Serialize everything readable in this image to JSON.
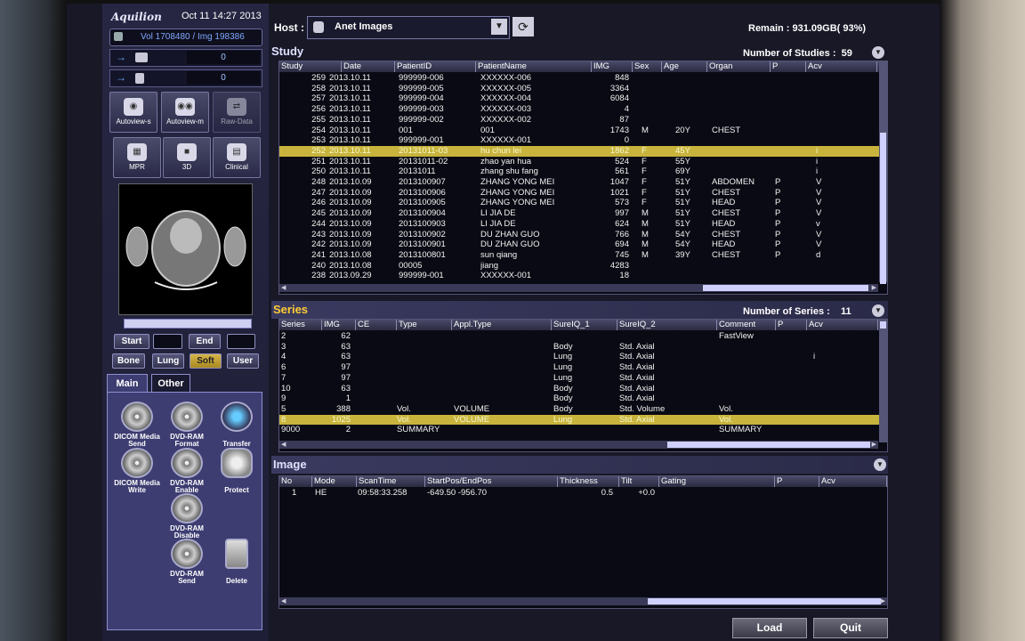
{
  "app": {
    "clock": "Oct 11 14:27 2013",
    "vol_info": "Vol 1708480 / Img 198386"
  },
  "queues": [
    {
      "value": "0"
    },
    {
      "value": "0"
    }
  ],
  "big_buttons": [
    {
      "label": "Autoview-s"
    },
    {
      "label": "Autoview-m"
    },
    {
      "label": "Raw-Data"
    },
    {
      "label": "MPR"
    },
    {
      "label": "3D"
    },
    {
      "label": "Clinical"
    }
  ],
  "range": {
    "start": "Start",
    "end": "End"
  },
  "windows": [
    "Bone",
    "Lung",
    "Soft",
    "User"
  ],
  "tabs": {
    "main": "Main",
    "other": "Other"
  },
  "actions": [
    {
      "label1": "DICOM Media",
      "label2": "Send"
    },
    {
      "label1": "DVD-RAM",
      "label2": "Format"
    },
    {
      "label1": "",
      "label2": "Transfer"
    },
    {
      "label1": "DICOM Media",
      "label2": "Write"
    },
    {
      "label1": "DVD-RAM",
      "label2": "Enable"
    },
    {
      "label1": "",
      "label2": "Protect"
    },
    {
      "label1": "DVD-RAM",
      "label2": "Disable"
    },
    {
      "label1": "DVD-RAM",
      "label2": "Send"
    },
    {
      "label1": "",
      "label2": "Delete"
    }
  ],
  "host": {
    "label": "Host :",
    "value": "Anet  Images"
  },
  "remain": "Remain : 931.09GB( 93%)",
  "study": {
    "title": "Study",
    "count_label": "Number of Studies :",
    "count": "59",
    "columns": [
      "Study",
      "Date",
      "PatientID",
      "PatientName",
      "IMG",
      "Sex",
      "Age",
      "Organ",
      "P",
      "Acv"
    ],
    "rows": [
      [
        "259",
        "2013.10.11",
        "999999-006",
        "XXXXXX-006",
        "848",
        "",
        "",
        "",
        "",
        ""
      ],
      [
        "258",
        "2013.10.11",
        "999999-005",
        "XXXXXX-005",
        "3364",
        "",
        "",
        "",
        "",
        ""
      ],
      [
        "257",
        "2013.10.11",
        "999999-004",
        "XXXXXX-004",
        "6084",
        "",
        "",
        "",
        "",
        ""
      ],
      [
        "256",
        "2013.10.11",
        "999999-003",
        "XXXXXX-003",
        "4",
        "",
        "",
        "",
        "",
        ""
      ],
      [
        "255",
        "2013.10.11",
        "999999-002",
        "XXXXXX-002",
        "87",
        "",
        "",
        "",
        "",
        ""
      ],
      [
        "254",
        "2013.10.11",
        "001",
        "001",
        "1743",
        "M",
        "20Y",
        "CHEST",
        "",
        ""
      ],
      [
        "253",
        "2013.10.11",
        "999999-001",
        "XXXXXX-001",
        "0",
        "",
        "",
        "",
        "",
        ""
      ],
      [
        "252",
        "2013.10.11",
        "20131011-03",
        "hu chun lei",
        "1862",
        "F",
        "45Y",
        "",
        "",
        "i"
      ],
      [
        "251",
        "2013.10.11",
        "20131011-02",
        "zhao yan hua",
        "524",
        "F",
        "55Y",
        "",
        "",
        "i"
      ],
      [
        "250",
        "2013.10.11",
        "20131011",
        "zhang shu fang",
        "561",
        "F",
        "69Y",
        "",
        "",
        "i"
      ],
      [
        "248",
        "2013.10.09",
        "2013100907",
        "ZHANG YONG MEI",
        "1047",
        "F",
        "51Y",
        "ABDOMEN",
        "P",
        "V"
      ],
      [
        "247",
        "2013.10.09",
        "2013100906",
        "ZHANG YONG MEI",
        "1021",
        "F",
        "51Y",
        "CHEST",
        "P",
        "V"
      ],
      [
        "246",
        "2013.10.09",
        "2013100905",
        "ZHANG YONG MEI",
        "573",
        "F",
        "51Y",
        "HEAD",
        "P",
        "V"
      ],
      [
        "245",
        "2013.10.09",
        "2013100904",
        "LI JIA DE",
        "997",
        "M",
        "51Y",
        "CHEST",
        "P",
        "V"
      ],
      [
        "244",
        "2013.10.09",
        "2013100903",
        "LI JIA DE",
        "624",
        "M",
        "51Y",
        "HEAD",
        "P",
        "v"
      ],
      [
        "243",
        "2013.10.09",
        "2013100902",
        "DU ZHAN GUO",
        "766",
        "M",
        "54Y",
        "CHEST",
        "P",
        "V"
      ],
      [
        "242",
        "2013.10.09",
        "2013100901",
        "DU ZHAN GUO",
        "694",
        "M",
        "54Y",
        "HEAD",
        "P",
        "V"
      ],
      [
        "241",
        "2013.10.08",
        "2013100801",
        "sun qiang",
        "745",
        "M",
        "39Y",
        "CHEST",
        "P",
        "d"
      ],
      [
        "240",
        "2013.10.08",
        "00005",
        "jiang",
        "4283",
        "",
        "",
        "",
        "",
        ""
      ],
      [
        "238",
        "2013.09.29",
        "999999-001",
        "XXXXXX-001",
        "18",
        "",
        "",
        "",
        "",
        ""
      ]
    ],
    "selected_index": 7
  },
  "series": {
    "title": "Series",
    "count_label": "Number of Series :",
    "count": "11",
    "columns": [
      "Series",
      "IMG",
      "CE",
      "Type",
      "Appl.Type",
      "SureIQ_1",
      "SureIQ_2",
      "Comment",
      "P",
      "Acv"
    ],
    "rows": [
      [
        "2",
        "62",
        "",
        "",
        "",
        "",
        "",
        "FastView",
        "",
        ""
      ],
      [
        "3",
        "63",
        "",
        "",
        "",
        "Body",
        "Std. Axial",
        "",
        "",
        ""
      ],
      [
        "4",
        "63",
        "",
        "",
        "",
        "Lung",
        "Std. Axial",
        "",
        "",
        "i"
      ],
      [
        "6",
        "97",
        "",
        "",
        "",
        "Lung",
        "Std. Axial",
        "",
        "",
        ""
      ],
      [
        "7",
        "97",
        "",
        "",
        "",
        "Lung",
        "Std. Axial",
        "",
        "",
        ""
      ],
      [
        "10",
        "63",
        "",
        "",
        "",
        "Body",
        "Std. Axial",
        "",
        "",
        ""
      ],
      [
        "9",
        "1",
        "",
        "",
        "",
        "Body",
        "Std. Axial",
        "",
        "",
        ""
      ],
      [
        "5",
        "388",
        "",
        "Vol.",
        "VOLUME",
        "Body",
        "Std. Volume",
        "Vol.",
        "",
        ""
      ],
      [
        "8",
        "1025",
        "",
        "Vol.",
        "VOLUME",
        "Lung",
        "Std. Axial",
        "Vol.",
        "",
        ""
      ],
      [
        "9000",
        "2",
        "",
        "SUMMARY",
        "",
        "",
        "",
        "SUMMARY",
        "",
        ""
      ]
    ],
    "selected_index": 8
  },
  "image": {
    "title": "Image",
    "columns": [
      "No",
      "Mode",
      "ScanTime",
      "StartPos/EndPos",
      "Thickness",
      "Tilt",
      "Gating",
      "P",
      "Acv"
    ],
    "rows": [
      [
        "1",
        "HE",
        "09:58:33.258",
        "-649.50   -956.70",
        "0.5",
        "+0.0",
        "",
        "",
        ""
      ]
    ]
  },
  "buttons": {
    "load": "Load",
    "quit": "Quit"
  },
  "colors": {
    "selected_row": "#c8b43c",
    "panel_bg": "#181827",
    "series_title": "#ffcc33"
  }
}
